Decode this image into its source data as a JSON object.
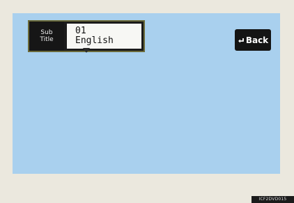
{
  "subtitle": {
    "label_line1": "Sub",
    "label_line2": "Title",
    "track_number": "01",
    "language": "English"
  },
  "back_button": {
    "label": "Back",
    "icon": "return-arrow-icon"
  },
  "footer": {
    "figure_code": "ICF2DVD015"
  },
  "colors": {
    "screen_background": "#a9d0ee",
    "panel_background": "#1a1a1a",
    "field_background": "#f7f7f4"
  }
}
